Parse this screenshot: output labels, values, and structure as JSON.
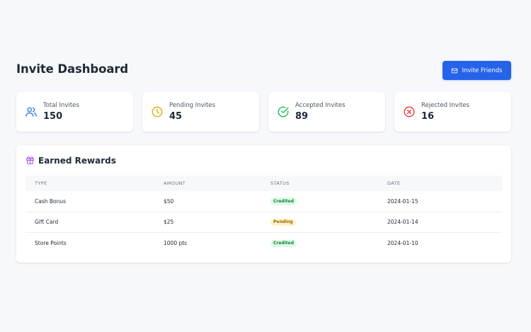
{
  "header": {
    "title": "Invite Dashboard",
    "invite_button": "Invite Friends"
  },
  "stats": [
    {
      "label": "Total Invites",
      "value": "150",
      "icon": "users-icon",
      "color": "#3b82f6"
    },
    {
      "label": "Pending Invites",
      "value": "45",
      "icon": "clock-icon",
      "color": "#eab308"
    },
    {
      "label": "Accepted Invites",
      "value": "89",
      "icon": "check-circle-icon",
      "color": "#22c55e"
    },
    {
      "label": "Rejected Invites",
      "value": "16",
      "icon": "x-circle-icon",
      "color": "#ef4444"
    }
  ],
  "rewards": {
    "title": "Earned Rewards",
    "icon": "gift-icon",
    "columns": [
      "TYPE",
      "AMOUNT",
      "STATUS",
      "DATE"
    ],
    "rows": [
      {
        "type": "Cash Bonus",
        "amount": "$50",
        "status": "Credited",
        "date": "2024-01-15"
      },
      {
        "type": "Gift Card",
        "amount": "$25",
        "status": "Pending",
        "date": "2024-01-14"
      },
      {
        "type": "Store Points",
        "amount": "1000 pts",
        "status": "Credited",
        "date": "2024-01-10"
      }
    ]
  },
  "colors": {
    "accent": "#2563eb",
    "credited": "#15803d",
    "pending": "#a16207",
    "gift": "#a855f7"
  }
}
